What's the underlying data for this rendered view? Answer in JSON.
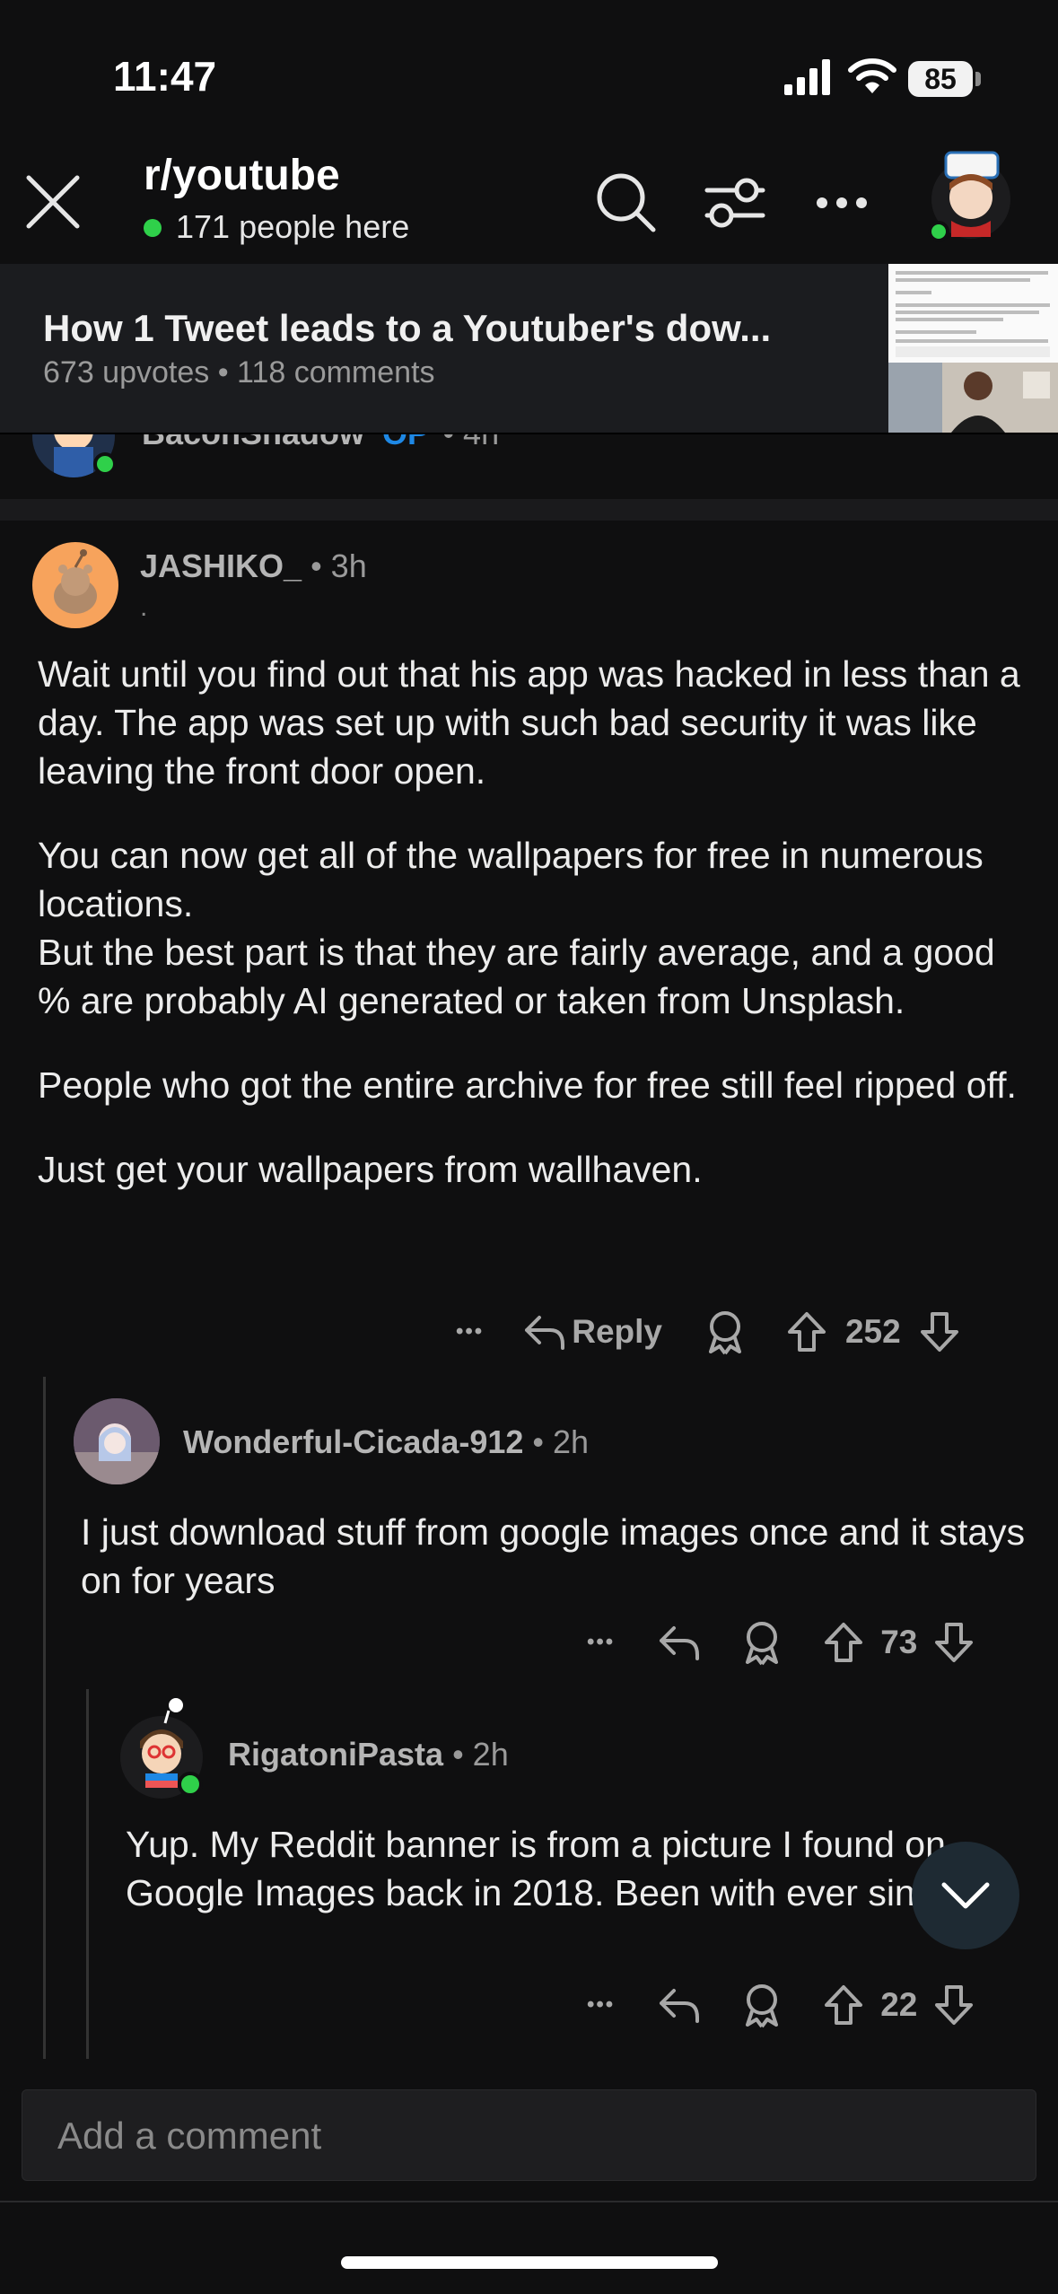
{
  "status_bar": {
    "time": "11:47",
    "battery": "85"
  },
  "header": {
    "subreddit": "r/youtube",
    "online_count": "171 people here"
  },
  "post": {
    "title": "How 1 Tweet leads to a Youtuber's dow...",
    "meta": "673 upvotes • 118 comments"
  },
  "prev_comment": {
    "author": "BaconShadow",
    "op_badge": "OP",
    "age": "• 4h"
  },
  "comments": [
    {
      "author": "JASHIKO_",
      "age": "• 3h",
      "flair": ".",
      "paragraphs": [
        "Wait until you find out that his app was hacked in less than a day. The app was set up with such bad security it was like leaving the front door open.",
        "You can now get all of the wallpapers for free in numerous locations.",
        "But the best part is that they are fairly average, and a good % are probably AI generated or taken from Unsplash.",
        "People who got the entire archive for free still feel ripped off.",
        "Just get your wallpapers from wallhaven."
      ],
      "more": "•••",
      "reply_label": "Reply",
      "votes": "252"
    },
    {
      "author": "Wonderful-Cicada-912",
      "age": "• 2h",
      "paragraphs": [
        "I just download stuff from google images once and it stays on for years"
      ],
      "more": "•••",
      "votes": "73"
    },
    {
      "author": "RigatoniPasta",
      "age": "• 2h",
      "paragraphs": [
        "Yup. My Reddit banner is from a picture I found on Google Images back in 2018. Been with ever since."
      ],
      "more": "•••",
      "votes": "22"
    }
  ],
  "composer": {
    "placeholder": "Add a comment"
  },
  "colors": {
    "online": "#2fd04a",
    "op": "#1e88e5",
    "background": "#0f0f10"
  }
}
